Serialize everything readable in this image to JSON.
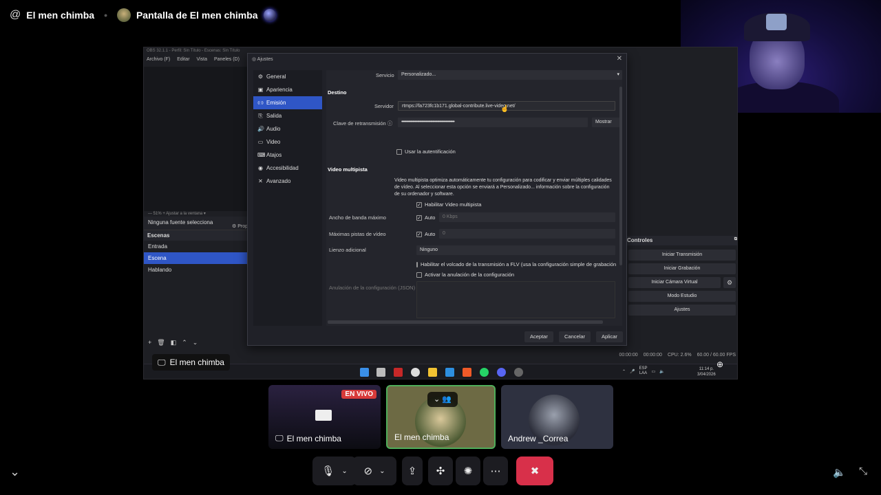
{
  "header": {
    "user_name": "El men chimba",
    "stream_title": "Pantalla de El men chimba"
  },
  "obs": {
    "window_title": "OBS 32.1.1 - Perfil: Sin Título - Escenas: Sin Título",
    "menu": [
      "Archivo (F)",
      "Editar",
      "Vista",
      "Paneles (D)"
    ],
    "preview_strip": "—  51%  +  Ajustar a la ventana  ▾",
    "no_source": "Ninguna fuente selecciona",
    "props_label": "Prop",
    "scenes_header": "Escenas",
    "scenes": [
      "Entrada",
      "Escena",
      "Hablando"
    ],
    "controls_header": "Controles",
    "controls": {
      "start_stream": "Iniciar Transmisión",
      "start_record": "Iniciar Grabación",
      "virtual_cam": "Iniciar Cámara Virtual",
      "studio_mode": "Modo Estudio",
      "settings": "Ajustes"
    },
    "status": {
      "stream_time": "00:00:00",
      "rec_time": "00:00:00",
      "cpu": "CPU: 2.6%",
      "fps": "60.00 / 60.00 FPS"
    },
    "tray": {
      "lang": "ESP",
      "layout": "LAA",
      "time": "11:14 p.",
      "date": "3/04/2026"
    }
  },
  "dialog": {
    "title": "Ajustes",
    "sidebar": [
      {
        "icon": "gear-icon",
        "glyph": "⚙",
        "label": "General"
      },
      {
        "icon": "appearance-icon",
        "glyph": "▣",
        "label": "Apariencia"
      },
      {
        "icon": "broadcast-icon",
        "glyph": "((·))",
        "label": "Emisión"
      },
      {
        "icon": "output-icon",
        "glyph": "⎘",
        "label": "Salida"
      },
      {
        "icon": "audio-icon",
        "glyph": "🔊",
        "label": "Audio"
      },
      {
        "icon": "video-icon",
        "glyph": "▭",
        "label": "Video"
      },
      {
        "icon": "keyboard-icon",
        "glyph": "⌨",
        "label": "Atajos"
      },
      {
        "icon": "accessibility-icon",
        "glyph": "◉",
        "label": "Accesibilidad"
      },
      {
        "icon": "wrench-icon",
        "glyph": "✕",
        "label": "Avanzado"
      }
    ],
    "service_label": "Servicio",
    "service_value": "Personalizado...",
    "destino_header": "Destino",
    "server_label": "Servidor",
    "server_value": "rtmps://fa723fc1b171.global-contribute.live-video.net/",
    "key_label": "Clave de retransmisión",
    "key_value": "•••••••••••••••••••••••••••••••••••••••••••••••••••••",
    "show_button": "Mostrar",
    "use_auth": "Usar la autentificación",
    "multitrack_header": "Video multipista",
    "multitrack_desc": "Video multipista optimiza automáticamente tu configuración para codificar y enviar múltiples calidades de vídeo. Al seleccionar esta opción se enviará a Personalizado... información sobre la configuración de su ordenador y software.",
    "enable_multitrack": "Habilitar Video multipista",
    "max_bandwidth_label": "Ancho de banda máximo",
    "auto_label": "Auto",
    "max_bandwidth_value": "0 Kbps",
    "max_tracks_label": "Máximas pistas de vídeo",
    "max_tracks_value": "0",
    "extra_canvas_label": "Lienzo adicional",
    "extra_canvas_value": "Ninguno",
    "flv_dump": "Habilitar el volcado de la transmisión a FLV (usa la configuración simple de grabación)",
    "config_override": "Activar la anulación de la configuración",
    "override_json_label": "Anulación de la configuración (JSON)",
    "buttons": {
      "accept": "Aceptar",
      "cancel": "Cancelar",
      "apply": "Aplicar"
    }
  },
  "share_label": "El men chimba",
  "participants": [
    {
      "name": "El men chimba",
      "badge": "EN VIVO"
    },
    {
      "name": "El men chimba"
    },
    {
      "name": "Andrew _Correa"
    }
  ],
  "colors": {
    "accent_blue": "#2f56c6",
    "live_red": "#d83a3a",
    "leave_red": "#d8304a",
    "speaking_green": "#4fae5a"
  }
}
